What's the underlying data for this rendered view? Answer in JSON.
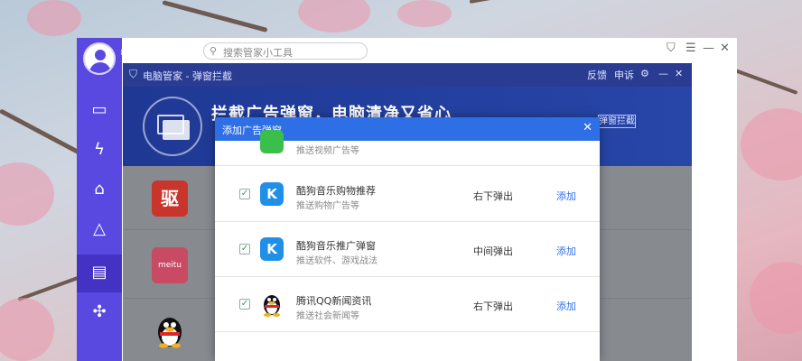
{
  "main_window": {
    "app_name": "电脑管家",
    "search_placeholder": "搜索管家小工具",
    "controls": [
      "⛉",
      "☰",
      "—",
      "✕"
    ]
  },
  "popup_window": {
    "title": "电脑管家 - 弹窗拦截",
    "feedback": "反馈",
    "appeal": "申诉",
    "hero_title": "拦截广告弹窗，电脑清净又省心",
    "hero_button": "弹窗拦截",
    "body_apps": [
      {
        "icon": "驱"
      },
      {
        "icon": "meitu"
      },
      {
        "icon": "qq-penguin"
      }
    ]
  },
  "dialog": {
    "title": "添加广告弹窗",
    "close": "✕",
    "partial_row": {
      "desc": "推送视频广告等"
    },
    "rows": [
      {
        "checked": true,
        "name": "酷狗音乐购物推荐",
        "desc": "推送购物广告等",
        "position": "右下弹出",
        "action": "添加"
      },
      {
        "checked": true,
        "name": "酷狗音乐推广弹窗",
        "desc": "推送软件、游戏战法",
        "position": "中间弹出",
        "action": "添加"
      },
      {
        "checked": true,
        "name": "腾讯QQ新闻资讯",
        "desc": "推送社会新闻等",
        "position": "右下弹出",
        "action": "添加"
      }
    ]
  }
}
